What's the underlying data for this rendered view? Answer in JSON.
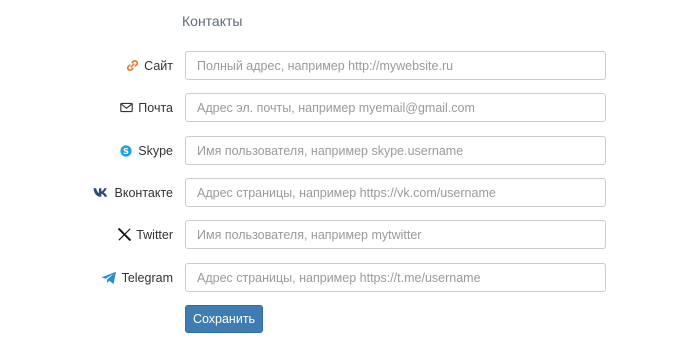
{
  "section": {
    "title": "Контакты"
  },
  "fields": [
    {
      "key": "site",
      "label": "Сайт",
      "icon": "link-icon",
      "icon_color": "#e8762c",
      "value": "",
      "placeholder": "Полный адрес, например http://mywebsite.ru"
    },
    {
      "key": "email",
      "label": "Почта",
      "icon": "envelope-icon",
      "icon_color": "#333333",
      "value": "",
      "placeholder": "Адрес эл. почты, например myemail@gmail.com"
    },
    {
      "key": "skype",
      "label": "Skype",
      "icon": "skype-icon",
      "icon_color": "#1da1e2",
      "value": "",
      "placeholder": "Имя пользователя, например skype.username"
    },
    {
      "key": "vk",
      "label": "Вконтакте",
      "icon": "vk-icon",
      "icon_color": "#2d4a7a",
      "value": "",
      "placeholder": "Адрес страницы, например https://vk.com/username"
    },
    {
      "key": "twitter",
      "label": "Twitter",
      "icon": "x-icon",
      "icon_color": "#111111",
      "value": "",
      "placeholder": "Имя пользователя, например mytwitter"
    },
    {
      "key": "telegram",
      "label": "Telegram",
      "icon": "telegram-icon",
      "icon_color": "#2a8fc8",
      "value": "",
      "placeholder": "Адрес страницы, например https://t.me/username"
    }
  ],
  "actions": {
    "save_label": "Сохранить",
    "save_color": "#3e7cb1"
  }
}
